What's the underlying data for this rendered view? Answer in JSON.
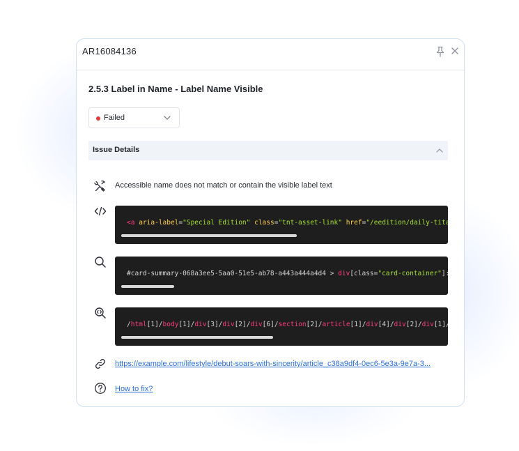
{
  "panel": {
    "title": "AR16084136",
    "rule_title": "2.5.3 Label in Name - Label Name Visible",
    "status": {
      "label": "Failed",
      "dot_color": "#e53935"
    },
    "section": {
      "label": "Issue Details",
      "expanded": true
    },
    "details": {
      "description": "Accessible name does not match or contain the visible label text",
      "html_snippet": {
        "open_bracket": "<a",
        "aria_attr": "aria-label",
        "aria_value": "\"Special Edition\"",
        "class_attr": "class",
        "class_value": "\"tnt-asset-link\"",
        "href_attr": "href",
        "href_value": "\"/eedition/daily-titan-"
      },
      "css_selector": {
        "prefix": "#card-summary-068a3ee5-5aa0-51e5-ab78-a443a444a4d4 > ",
        "tag": "div",
        "open": "[class=",
        "value": "\"card-container\"",
        "suffix": "]:nth"
      },
      "xpath": [
        {
          "tag": "html",
          "index": "[1]"
        },
        {
          "tag": "body",
          "index": "[1]"
        },
        {
          "tag": "div",
          "index": "[3]"
        },
        {
          "tag": "div",
          "index": "[2]"
        },
        {
          "tag": "div",
          "index": "[6]"
        },
        {
          "tag": "section",
          "index": "[2]"
        },
        {
          "tag": "article",
          "index": "[1]"
        },
        {
          "tag": "div",
          "index": "[4]"
        },
        {
          "tag": "div",
          "index": "[2]"
        },
        {
          "tag": "div",
          "index": "[1]"
        },
        {
          "tag": "di",
          "index": ""
        }
      ],
      "page_url": "https://example.com/lifestyle/debut-soars-with-sincerity/article_c38a9df4-0ec6-5e3a-9e7a-3...",
      "how_to_fix": "How to fix?"
    },
    "icons": {
      "pin": "pin-icon",
      "close": "close-icon",
      "tools": "tools-icon",
      "code": "code-icon",
      "search": "search-icon",
      "xpath": "zoom-code-icon",
      "link": "link-icon",
      "help": "help-icon"
    },
    "colors": {
      "panel_border": "#cfe0f3",
      "code_bg": "#1e1e1e",
      "tag": "#ff3d7f",
      "attr": "#ffd04a",
      "value": "#a6e22e",
      "link": "#2a6fdb"
    }
  }
}
